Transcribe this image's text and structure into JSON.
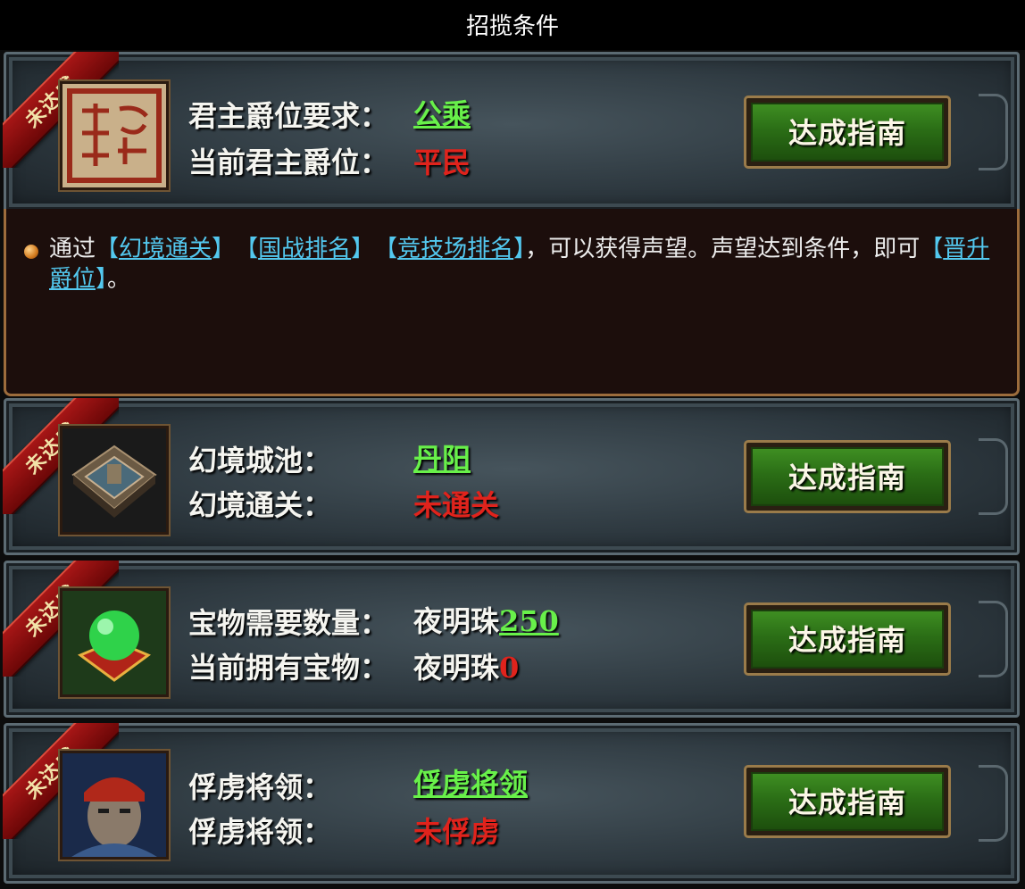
{
  "window": {
    "title": "招揽条件"
  },
  "badge_text": "未达成",
  "guide_button_label": "达成指南",
  "colors": {
    "met": "#68f04a",
    "unmet": "#e0231c",
    "link": "#53c8ef"
  },
  "panels": [
    {
      "icon": "seal-stamp-icon",
      "label1": "君主爵位要求：",
      "value1": "公乘",
      "label2": "当前君主爵位：",
      "value2": "平民"
    },
    {
      "icon": "fortress-city-icon",
      "label1": "幻境城池：",
      "value1": "丹阳",
      "label2": "幻境通关：",
      "value2": "未通关"
    },
    {
      "icon": "night-pearl-icon",
      "label1": "宝物需要数量：",
      "value1_prefix": "夜明珠",
      "value1": "250",
      "label2": "当前拥有宝物：",
      "value2_prefix": "夜明珠",
      "value2": "0"
    },
    {
      "icon": "general-portrait-icon",
      "label1": "俘虏将领：",
      "value1": "俘虏将领",
      "label2": "俘虏将领：",
      "value2": "未俘虏"
    }
  ],
  "description": {
    "lead": "通过",
    "link1": "幻境通关",
    "link2": "国战排名",
    "link3": "竞技场排名",
    "middle": "，可以获得声望。声望达到条件，即可",
    "link4": "晋升爵位",
    "end": "。"
  }
}
